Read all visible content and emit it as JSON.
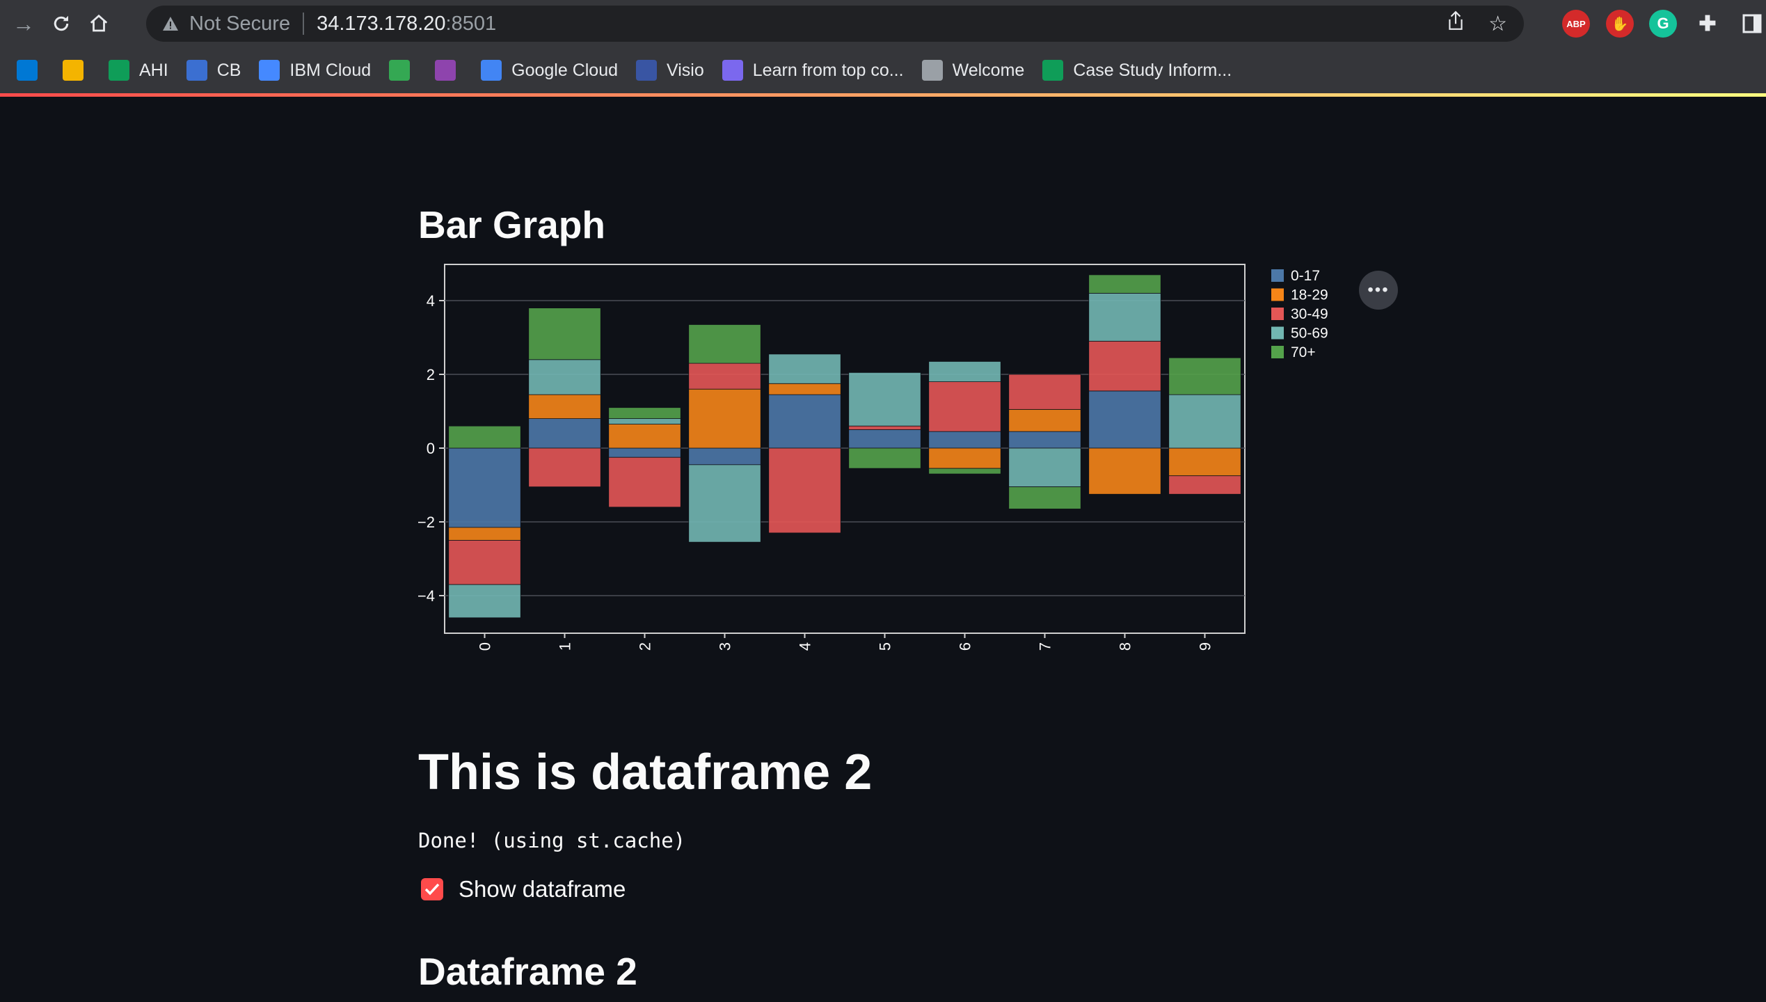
{
  "browser": {
    "security_label": "Not Secure",
    "url_host": "34.173.178.20",
    "url_port": ":8501",
    "extensions": {
      "abp": "ABP"
    },
    "bookmarks": [
      {
        "label": "",
        "icon": "azure-icon",
        "color": "#0078d4"
      },
      {
        "label": "",
        "icon": "slides-icon",
        "color": "#f4b400"
      },
      {
        "label": "AHI",
        "icon": "sheets-icon",
        "color": "#0f9d58"
      },
      {
        "label": "CB",
        "icon": "cb-icon",
        "color": "#3b6fd1"
      },
      {
        "label": "IBM Cloud",
        "icon": "ibm-cloud-icon",
        "color": "#4589ff"
      },
      {
        "label": "",
        "icon": "drive-icon",
        "color": "#34a853"
      },
      {
        "label": "",
        "icon": "classroom-icon",
        "color": "#8e44ad"
      },
      {
        "label": "Google Cloud",
        "icon": "google-cloud-icon",
        "color": "#4285f4"
      },
      {
        "label": "Visio",
        "icon": "visio-icon",
        "color": "#3955a3"
      },
      {
        "label": "Learn from top co...",
        "icon": "learn-icon",
        "color": "#7b68ee"
      },
      {
        "label": "Welcome",
        "icon": "globe-icon",
        "color": "#9aa0a6"
      },
      {
        "label": "Case Study Inform...",
        "icon": "sheets-icon",
        "color": "#0f9d58"
      }
    ]
  },
  "page": {
    "bar_graph_heading": "Bar Graph",
    "dataframe_heading": "This is dataframe 2",
    "done_text": "Done! (using st.cache)",
    "checkbox_label": "Show dataframe",
    "dataframe2_heading": "Dataframe 2"
  },
  "chart_data": {
    "type": "bar",
    "stacked": true,
    "categories": [
      "0",
      "1",
      "2",
      "3",
      "4",
      "5",
      "6",
      "7",
      "8",
      "9"
    ],
    "ylim": [
      -5,
      5
    ],
    "yticks": [
      -4,
      -2,
      0,
      2,
      4
    ],
    "legend_position": "right",
    "grid": true,
    "series": [
      {
        "name": "0-17",
        "color": "#4c78a8",
        "values": [
          -2.15,
          0.8,
          -0.25,
          -0.45,
          1.45,
          0.5,
          0.45,
          0.45,
          1.55,
          0
        ]
      },
      {
        "name": "18-29",
        "color": "#f58518",
        "values": [
          -0.35,
          0.65,
          0.65,
          1.6,
          0.3,
          0,
          -0.55,
          0.6,
          -1.25,
          -0.75
        ]
      },
      {
        "name": "30-49",
        "color": "#e45756",
        "values": [
          -1.2,
          -1.05,
          -1.35,
          0.7,
          -2.3,
          0.1,
          1.35,
          0.95,
          1.35,
          -0.5
        ]
      },
      {
        "name": "50-69",
        "color": "#72b7b2",
        "values": [
          -0.9,
          0.95,
          0.15,
          -2.1,
          0.8,
          1.45,
          0.55,
          -1.05,
          1.3,
          1.45
        ]
      },
      {
        "name": "70+",
        "color": "#54a24b",
        "values": [
          0.6,
          1.4,
          0.3,
          1.05,
          0,
          -0.55,
          -0.15,
          -0.6,
          0.5,
          1.0
        ]
      }
    ]
  }
}
